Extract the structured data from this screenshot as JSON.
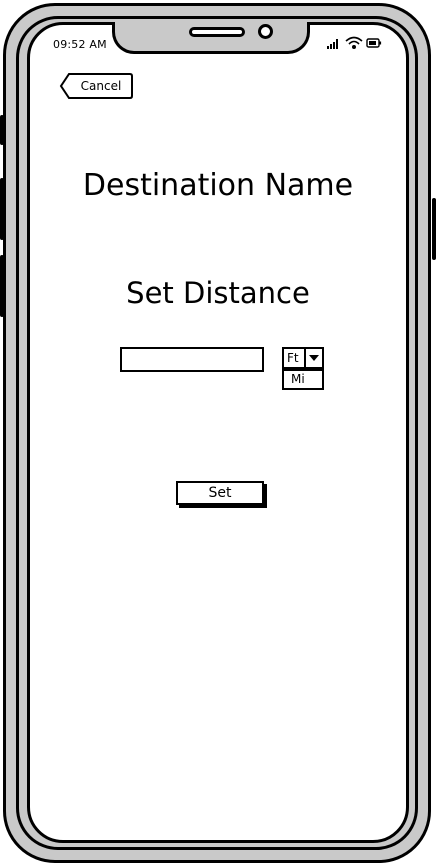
{
  "status_bar": {
    "time": "09:52 AM",
    "icons": [
      "signal-icon",
      "wifi-icon",
      "battery-icon"
    ]
  },
  "nav": {
    "cancel_label": "Cancel"
  },
  "main": {
    "destination_title": "Destination Name",
    "set_distance_heading": "Set Distance",
    "distance_input": {
      "value": "",
      "placeholder": ""
    },
    "unit_select": {
      "selected": "Ft",
      "options": [
        "Mi"
      ]
    },
    "set_label": "Set"
  },
  "colors": {
    "frame": "#c9c9c9",
    "stroke": "#000000",
    "screen": "#ffffff"
  }
}
